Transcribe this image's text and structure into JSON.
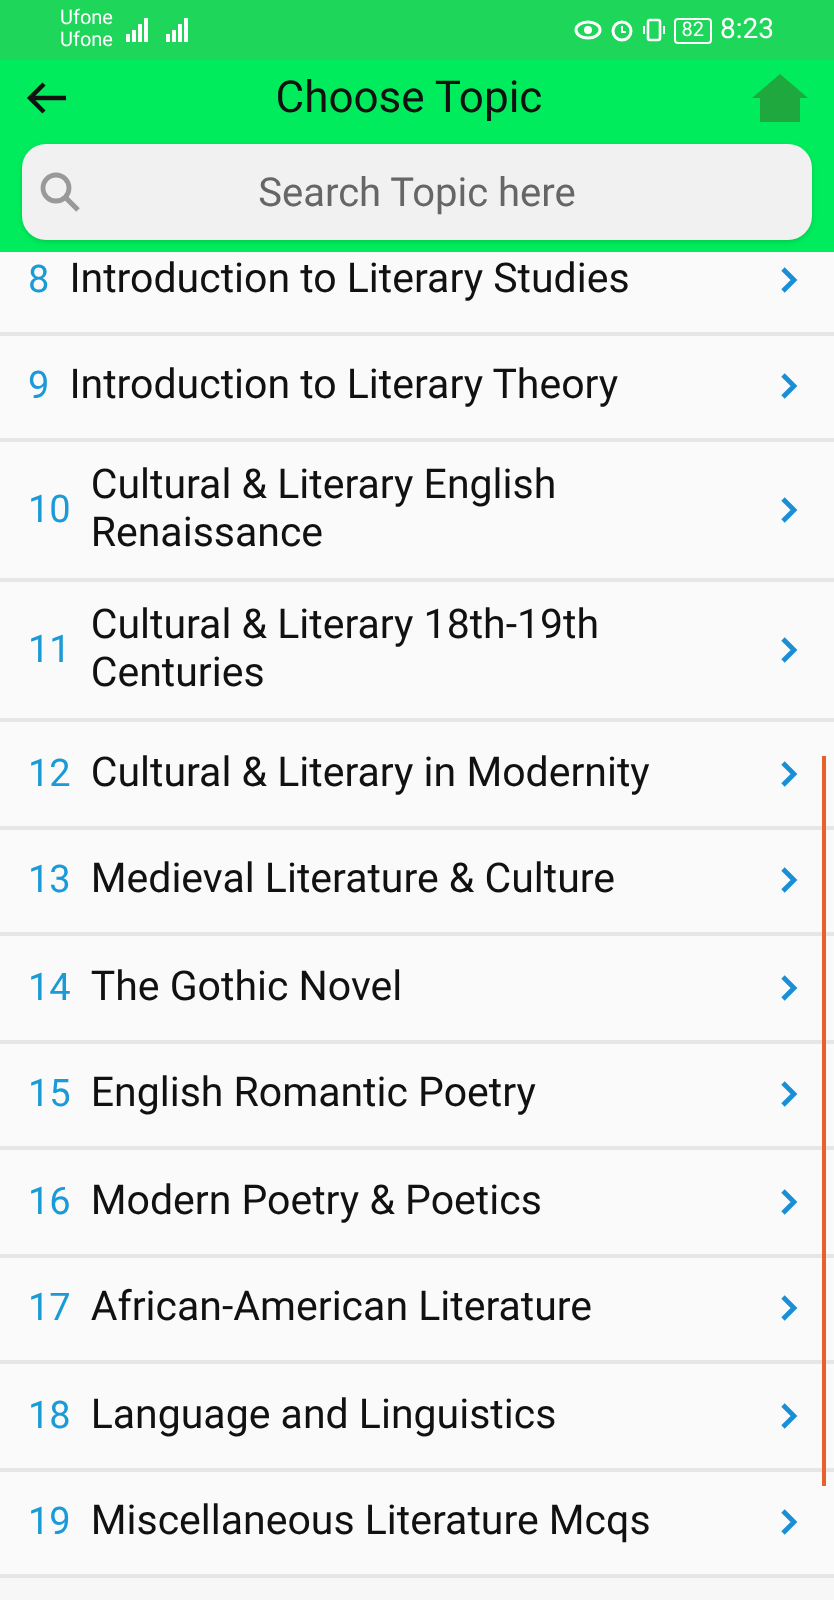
{
  "status_bar": {
    "carriers": [
      "Ufone",
      "Ufone"
    ],
    "battery": "82",
    "time": "8:23"
  },
  "header": {
    "title": "Choose Topic"
  },
  "search": {
    "placeholder": "Search Topic here"
  },
  "topics": [
    {
      "number": "8",
      "title": "Introduction to Literary Studies"
    },
    {
      "number": "9",
      "title": "Introduction to Literary Theory"
    },
    {
      "number": "10",
      "title": "Cultural & Literary English Renaissance"
    },
    {
      "number": "11",
      "title": "Cultural & Literary 18th-19th Centuries"
    },
    {
      "number": "12",
      "title": "Cultural & Literary in Modernity"
    },
    {
      "number": "13",
      "title": "Medieval Literature & Culture"
    },
    {
      "number": "14",
      "title": "The Gothic Novel"
    },
    {
      "number": "15",
      "title": "English Romantic Poetry"
    },
    {
      "number": "16",
      "title": "Modern Poetry & Poetics"
    },
    {
      "number": "17",
      "title": "African-American Literature"
    },
    {
      "number": "18",
      "title": "Language and Linguistics"
    },
    {
      "number": "19",
      "title": "Miscellaneous Literature Mcqs"
    }
  ]
}
